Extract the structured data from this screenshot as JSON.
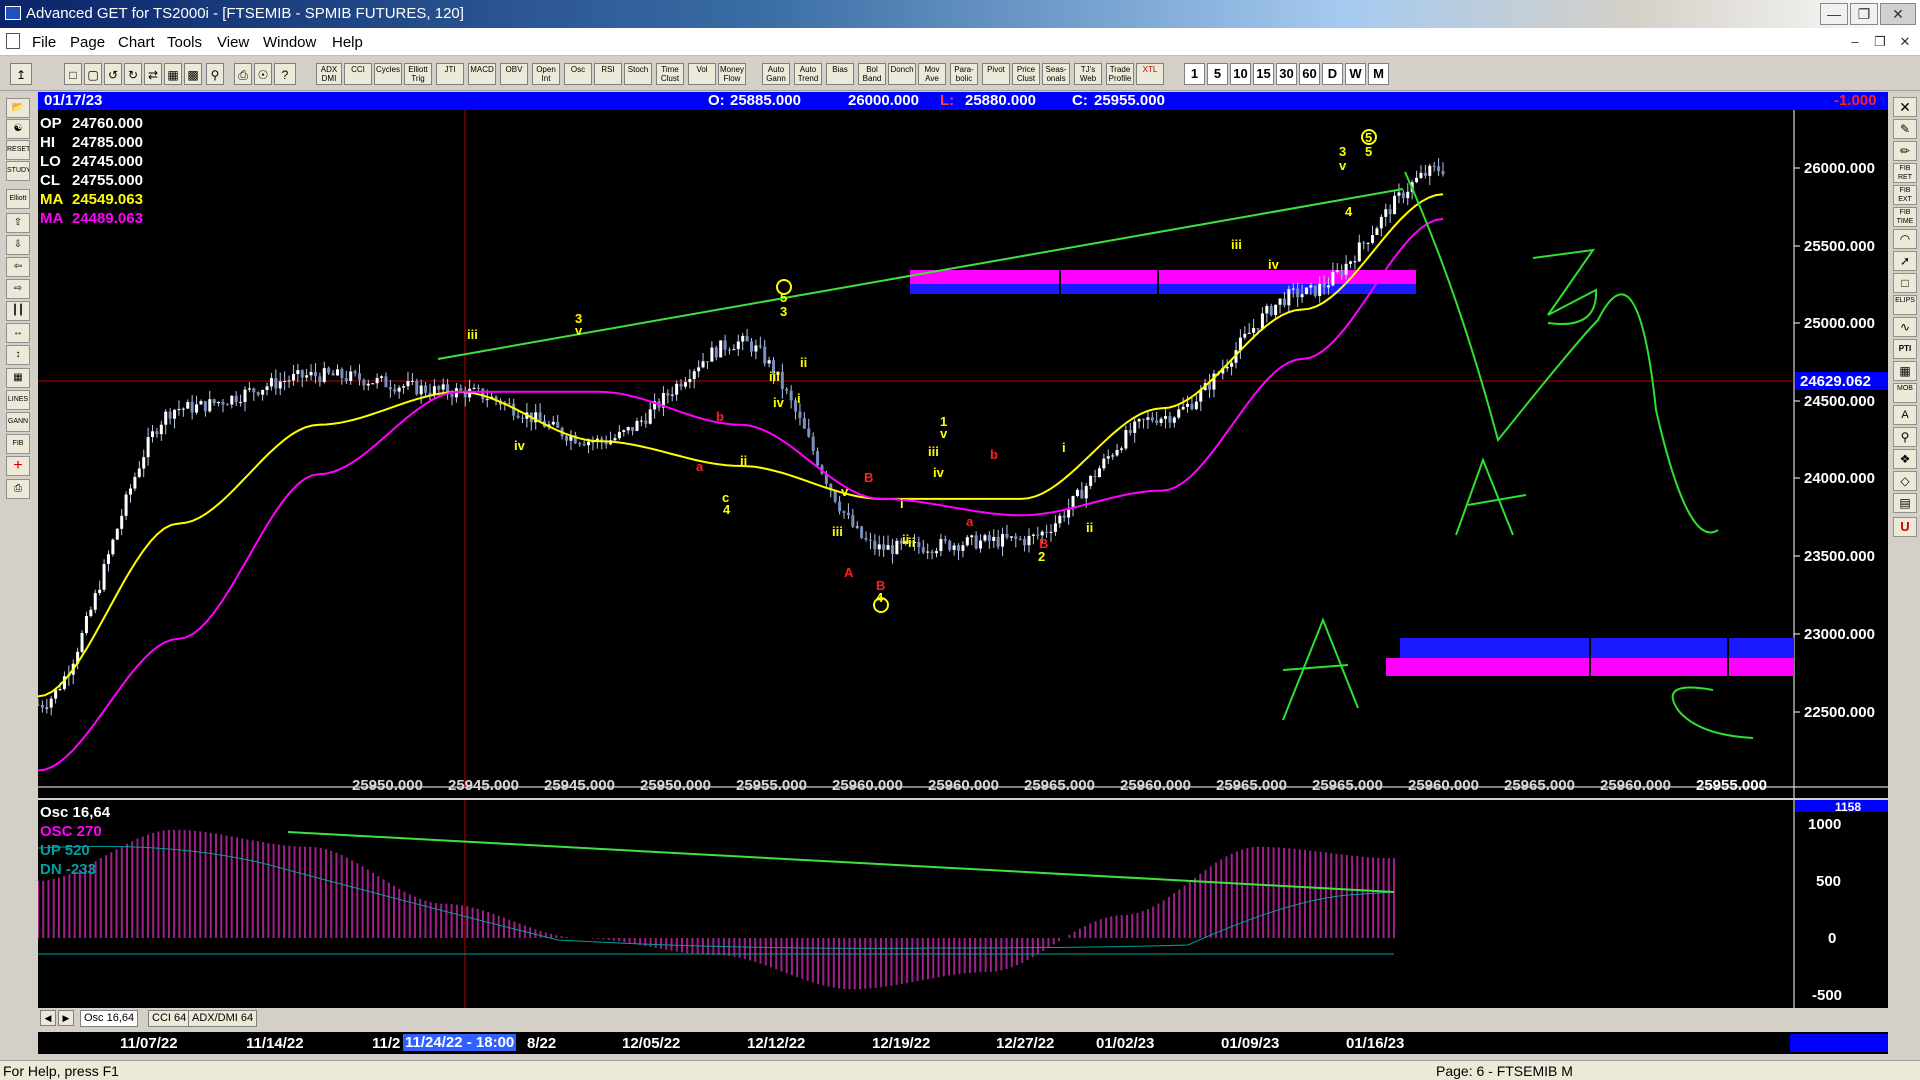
{
  "window": {
    "title": "Advanced GET for TS2000i - [FTSEMIB - SPMIB FUTURES, 120]"
  },
  "menu": [
    {
      "id": "file",
      "label": "File"
    },
    {
      "id": "page",
      "label": "Page"
    },
    {
      "id": "chart",
      "label": "Chart"
    },
    {
      "id": "tools",
      "label": "Tools"
    },
    {
      "id": "view",
      "label": "View"
    },
    {
      "id": "window",
      "label": "Window"
    },
    {
      "id": "help",
      "label": "Help"
    }
  ],
  "toolbar": {
    "study_buttons": [
      "ADX DMI",
      "CCI",
      "Cycles",
      "Elliott Trig",
      "JTI",
      "MACD",
      "OBV",
      "Open Int",
      "Osc",
      "RSI",
      "Stoch",
      "Time Clust",
      "Vol",
      "Money Flow",
      "Auto Gann",
      "Auto Trend",
      "Bias",
      "Bol Band",
      "Donch",
      "Mov Ave",
      "Para-bolic",
      "Pivot",
      "Price Clust",
      "Seas-onals",
      "TJ's Web",
      "Trade Profile",
      "XTL"
    ],
    "timeframes": [
      "1",
      "5",
      "10",
      "15",
      "30",
      "60",
      "D",
      "W",
      "M"
    ]
  },
  "left_tools": [
    "open-icon",
    "pitchfork-icon",
    "RESET",
    "STUDY",
    "Elliott",
    "up-arrow-icon",
    "down-arrow-icon",
    "left-arrow-icon",
    "right-arrow-icon",
    "bars-icon",
    "expand-icon",
    "compress-icon",
    "grid-icon",
    "LINES",
    "GANN",
    "FIB",
    "crosshair-icon",
    "print-icon"
  ],
  "right_tools": [
    "X",
    "pen",
    "pen",
    "FIB RET",
    "FIB EXT",
    "FIB TIME",
    "arc",
    "arrow",
    "box",
    "ELIPS",
    "zig",
    "PTI",
    "grid",
    "MOB",
    "A",
    "zoom",
    "pin",
    "marker",
    "book",
    "U"
  ],
  "chart_header": {
    "date": "01/17/23",
    "open_label": "O:",
    "open": "25885.000",
    "high": "26000.000",
    "low_label": "L:",
    "low": "25880.000",
    "close_label": "C:",
    "close": "25955.000",
    "change": "-1.000"
  },
  "legend": [
    {
      "label": "OP",
      "value": "24760.000",
      "color": "#ffffff"
    },
    {
      "label": "HI",
      "value": "24785.000",
      "color": "#ffffff"
    },
    {
      "label": "LO",
      "value": "24745.000",
      "color": "#ffffff"
    },
    {
      "label": "CL",
      "value": "24755.000",
      "color": "#ffffff"
    },
    {
      "label": "MA",
      "value": "24549.063",
      "color": "#ffff00"
    },
    {
      "label": "MA",
      "value": "24489.063",
      "color": "#ff00ff"
    }
  ],
  "price_axis": {
    "ticks": [
      "26000.000",
      "25500.000",
      "25000.000",
      "24500.000",
      "24000.000",
      "23500.000",
      "23000.000",
      "22500.000"
    ],
    "cursor": "24629.062"
  },
  "bottom_price_labels": [
    "25950.000",
    "25945.000",
    "25945.000",
    "25950.000",
    "25955.000",
    "25960.000",
    "25960.000",
    "25965.000",
    "25960.000",
    "25965.000",
    "25965.000",
    "25960.000",
    "25965.000",
    "25960.000",
    "25955.000"
  ],
  "wave_labels": {
    "yellow": [
      "iii",
      "3",
      "v",
      "iv",
      "3",
      "5",
      "iii",
      "ii",
      "i",
      "iv",
      "ii",
      "c",
      "4",
      "iii",
      "ii",
      "v",
      "i",
      "ii",
      "1",
      "v",
      "iii",
      "iv",
      "i",
      "2",
      "ii",
      "iii",
      "iv",
      "3",
      "v",
      "5",
      "5",
      "4",
      "4"
    ],
    "red": [
      "b",
      "a",
      "B",
      "A",
      "b",
      "a",
      "B",
      "B"
    ]
  },
  "hand_drawn": [
    "A",
    "B",
    "A",
    "C"
  ],
  "osc_legend": [
    {
      "label": "Osc 16,64",
      "color": "#ffffff"
    },
    {
      "label": "OSC 270",
      "color": "#ff00ff"
    },
    {
      "label": "UP  520",
      "color": "#00a0a0"
    },
    {
      "label": "DN  -233",
      "color": "#00a0a0"
    }
  ],
  "osc_axis": {
    "ticks": [
      "1000",
      "500",
      "0",
      "-500"
    ],
    "top_value": "1158"
  },
  "osc_tabs": [
    "Osc 16,64",
    "CCI 64",
    "ADX/DMI 64"
  ],
  "date_axis": {
    "labels": [
      "11/07/22",
      "11/14/22",
      "11/2",
      "8/22",
      "12/05/22",
      "12/12/22",
      "12/19/22",
      "12/27/22",
      "01/02/23",
      "01/09/23",
      "01/16/23"
    ],
    "cursor": "11/24/22 - 18:00"
  },
  "status": {
    "help": "For Help, press F1",
    "page": "Page: 6 - FTSEMIB M"
  },
  "chart_data": {
    "type": "candlestick",
    "instrument": "FTSEMIB - SPMIB FUTURES, 120",
    "y_range": [
      22200,
      26250
    ],
    "x": [
      "11/07/22",
      "11/14/22",
      "11/21/22",
      "11/28/22",
      "12/05/22",
      "12/12/22",
      "12/19/22",
      "12/27/22",
      "01/02/23",
      "01/09/23",
      "01/16/23"
    ],
    "close": [
      22700,
      24500,
      24700,
      24600,
      24300,
      24900,
      23650,
      23700,
      24450,
      25200,
      25955
    ],
    "ma_yellow": [
      22750,
      23800,
      24400,
      24600,
      24300,
      24150,
      23950,
      23950,
      24500,
      25100,
      25800
    ],
    "ma_magenta": [
      22300,
      23100,
      24100,
      24600,
      24600,
      24400,
      23950,
      23850,
      24000,
      24800,
      25650
    ],
    "oscillator": [
      500,
      950,
      800,
      300,
      0,
      -150,
      -450,
      -300,
      200,
      800,
      700
    ],
    "osc_up": 520,
    "osc_dn": -233
  }
}
